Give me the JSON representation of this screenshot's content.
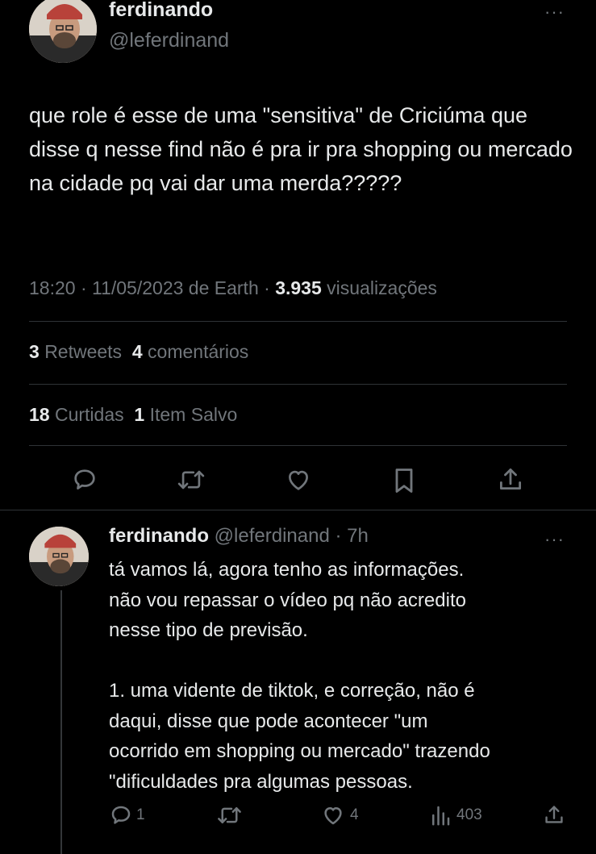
{
  "main_tweet": {
    "display_name": "ferdinando",
    "handle": "@leferdinand",
    "text": "que role é esse de uma \"sensitiva\" de Criciúma que disse q nesse find não é pra ir pra shopping ou mercado na cidade pq vai dar uma merda?????",
    "time": "18:20 · 11/05/2023 de Earth ·",
    "views_count": "3.935",
    "views_label": "visualizações",
    "retweets_count": "3",
    "retweets_label": "Retweets",
    "comments_count": "4",
    "comments_label": "comentários",
    "likes_count": "18",
    "likes_label": "Curtidas",
    "saved_count": "1",
    "saved_label": "Item Salvo",
    "more": "···"
  },
  "reply": {
    "display_name": "ferdinando",
    "handle": "@leferdinand · 7h",
    "text": "tá vamos lá, agora tenho as informações.\nnão vou repassar o vídeo pq não acredito\nnesse tipo de previsão.\n\n1. uma vidente de tiktok, e correção, não é\ndaqui, disse que pode acontecer \"um\nocorrido em shopping ou mercado\" trazendo\n\"dificuldades pra algumas pessoas.",
    "reply_count": "1",
    "like_count": "4",
    "view_count": "403",
    "more": "···"
  },
  "icons": {
    "reply": "speech-bubble-icon",
    "retweet": "retweet-arrows-icon",
    "like": "heart-icon",
    "bookmark": "bookmark-icon",
    "share": "share-upload-icon",
    "views": "bar-chart-icon"
  },
  "colors": {
    "background": "#000000",
    "text": "#e7e9ea",
    "muted": "#71767b",
    "divider": "#2f3336"
  }
}
